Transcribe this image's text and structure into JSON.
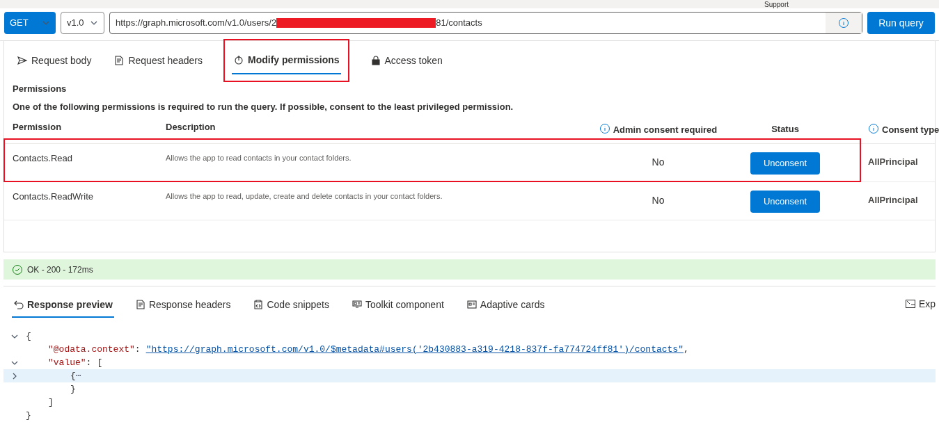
{
  "top_bar": {
    "text": "Support"
  },
  "query_bar": {
    "method": "GET",
    "version": "v1.0",
    "url_start": "https://graph.microsoft.com/v1.0/users/2",
    "url_redacted": true,
    "url_end": "81/contacts",
    "run_button": "Run query"
  },
  "request_tabs": [
    {
      "label": "Request body",
      "selected": false,
      "highlighted": false
    },
    {
      "label": "Request headers",
      "selected": false,
      "highlighted": false
    },
    {
      "label": "Modify permissions",
      "selected": true,
      "highlighted": true
    },
    {
      "label": "Access token",
      "selected": false,
      "highlighted": false
    }
  ],
  "permissions": {
    "title": "Permissions",
    "note": "One of the following permissions is required to run the query. If possible, consent to the least privileged permission.",
    "columns": [
      {
        "label": "Permission",
        "info": false
      },
      {
        "label": "Description",
        "info": false
      },
      {
        "label": "Admin consent required",
        "info": true
      },
      {
        "label": "Status",
        "info": false
      },
      {
        "label": "Consent type",
        "info": true
      }
    ],
    "rows": [
      {
        "permission": "Contacts.Read",
        "description": "Allows the app to read contacts in your contact folders.",
        "admin_consent": "No",
        "action": "Unconsent",
        "consent_type": "AllPrincipal",
        "highlighted": true
      },
      {
        "permission": "Contacts.ReadWrite",
        "description": "Allows the app to read, update, create and delete contacts in your contact folders.",
        "admin_consent": "No",
        "action": "Unconsent",
        "consent_type": "AllPrincipal",
        "highlighted": false
      }
    ]
  },
  "status_bar": {
    "text": "OK - 200 - 172ms",
    "kind": "success"
  },
  "response_tabs": [
    {
      "label": "Response preview",
      "selected": true
    },
    {
      "label": "Response headers",
      "selected": false
    },
    {
      "label": "Code snippets",
      "selected": false
    },
    {
      "label": "Toolkit component",
      "selected": false
    },
    {
      "label": "Adaptive cards",
      "selected": false
    }
  ],
  "expand_button": "Exp",
  "response": {
    "open": "{",
    "expanded": true,
    "close": "}",
    "children": [
      {
        "key": "\"@odata.context\"",
        "separator": ":",
        "value": "\"https://graph.microsoft.com/v1.0/$metadata#users('2b430883-a319-4218-837f-fa774724ff81')/contacts\"",
        "trailing": ","
      },
      {
        "key": "\"value\"",
        "separator": ":",
        "open": "[",
        "expanded": true,
        "close": "]",
        "children": [
          {
            "open": "{",
            "expanded": false,
            "ellipsis": "⋯",
            "close": "}",
            "highlighted": true
          }
        ]
      }
    ]
  }
}
